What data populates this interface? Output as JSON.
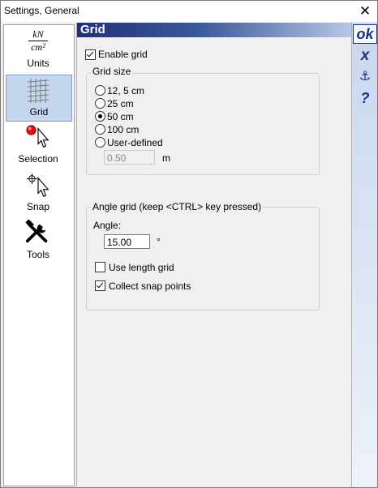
{
  "window": {
    "title": "Settings, General",
    "close_glyph": "✕"
  },
  "sidebar": {
    "items": [
      {
        "label": "Units",
        "icon": "units-icon",
        "selected": false,
        "fraction_num": "kN",
        "fraction_den": "cm²"
      },
      {
        "label": "Grid",
        "icon": "grid-icon",
        "selected": true
      },
      {
        "label": "Selection",
        "icon": "selection-icon",
        "selected": false
      },
      {
        "label": "Snap",
        "icon": "snap-icon",
        "selected": false
      },
      {
        "label": "Tools",
        "icon": "tools-icon",
        "selected": false
      }
    ]
  },
  "main": {
    "header": "Grid",
    "enable_grid": {
      "label": "Enable grid",
      "checked": true
    },
    "grid_size": {
      "title": "Grid size",
      "options": [
        {
          "label": "12, 5 cm",
          "selected": false
        },
        {
          "label": "25 cm",
          "selected": false
        },
        {
          "label": "50 cm",
          "selected": true
        },
        {
          "label": "100 cm",
          "selected": false
        },
        {
          "label": "User-defined",
          "selected": false
        }
      ],
      "user_value": "0.50",
      "user_unit": "m"
    },
    "angle_grid": {
      "title": "Angle grid (keep <CTRL> key pressed)",
      "angle_label": "Angle:",
      "angle_value": "15.00",
      "angle_unit": "°",
      "use_length_grid": {
        "label": "Use length grid",
        "checked": false
      },
      "collect_snap_points": {
        "label": "Collect snap points",
        "checked": true
      }
    }
  },
  "toolbar": {
    "ok_label": "ok",
    "cancel_label": "x",
    "anchor_glyph": "⚓",
    "help_label": "?"
  },
  "colors": {
    "accent": "#1c2f82",
    "selected_bg": "#c5d7ee",
    "header_start": "#20307a"
  }
}
